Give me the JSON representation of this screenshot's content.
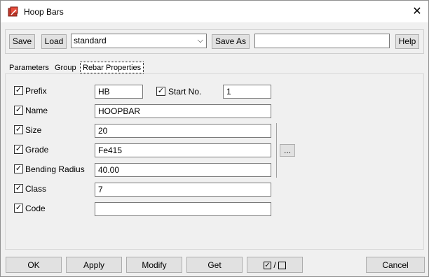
{
  "window": {
    "title": "Hoop Bars"
  },
  "toolbar": {
    "save_label": "Save",
    "load_label": "Load",
    "preset_value": "standard",
    "save_as_label": "Save As",
    "save_as_value": "",
    "help_label": "Help"
  },
  "tabs": [
    {
      "label": "Parameters"
    },
    {
      "label": "Group"
    },
    {
      "label": "Rebar Properties",
      "active": true
    }
  ],
  "rebar": {
    "prefix": {
      "label": "Prefix",
      "value": "HB",
      "checked": true
    },
    "start_no": {
      "label": "Start No.",
      "value": "1",
      "checked": true
    },
    "name": {
      "label": "Name",
      "value": "HOOPBAR",
      "checked": true
    },
    "size": {
      "label": "Size",
      "value": "20",
      "checked": true
    },
    "grade": {
      "label": "Grade",
      "value": "Fe415",
      "checked": true,
      "browse_label": "..."
    },
    "bending_radius": {
      "label": "Bending Radius",
      "value": "40.00",
      "checked": true
    },
    "class": {
      "label": "Class",
      "value": "7",
      "checked": true
    },
    "code": {
      "label": "Code",
      "value": "",
      "checked": true
    }
  },
  "buttons": {
    "ok": "OK",
    "apply": "Apply",
    "modify": "Modify",
    "get": "Get",
    "toggle_separator": "/",
    "cancel": "Cancel"
  },
  "icons": {
    "app": "hoop-bars-app-icon",
    "close": "close-icon"
  }
}
